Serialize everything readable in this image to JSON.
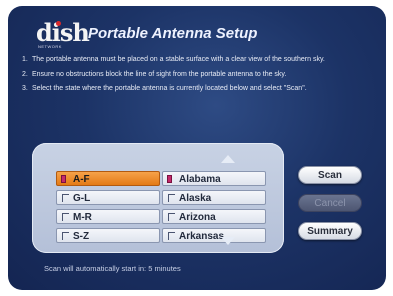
{
  "header": {
    "logo_text": "dish",
    "logo_sub": "NETWORK",
    "title": "Portable Antenna Setup"
  },
  "instructions": [
    {
      "num": "1.",
      "text": "The portable antenna must be placed on a stable surface with a clear view of the southern sky."
    },
    {
      "num": "2.",
      "text": "Ensure no obstructions block the line of sight from the portable antenna to the sky."
    },
    {
      "num": "3.",
      "text": "Select the state where the portable antenna is currently located below and select \"Scan\"."
    }
  ],
  "letter_groups": [
    {
      "label": "A-F",
      "selected": true
    },
    {
      "label": "G-L",
      "selected": false
    },
    {
      "label": "M-R",
      "selected": false
    },
    {
      "label": "S-Z",
      "selected": false
    }
  ],
  "states": [
    {
      "label": "Alabama",
      "flagged": true
    },
    {
      "label": "Alaska",
      "flagged": false
    },
    {
      "label": "Arizona",
      "flagged": false
    },
    {
      "label": "Arkansas",
      "flagged": false
    }
  ],
  "buttons": {
    "scan": "Scan",
    "cancel": "Cancel",
    "summary": "Summary"
  },
  "status_text": "Scan will automatically start in: 5 minutes",
  "colors": {
    "background": "#1c3366",
    "selected": "#e47a16",
    "flag": "#c42a6a"
  }
}
